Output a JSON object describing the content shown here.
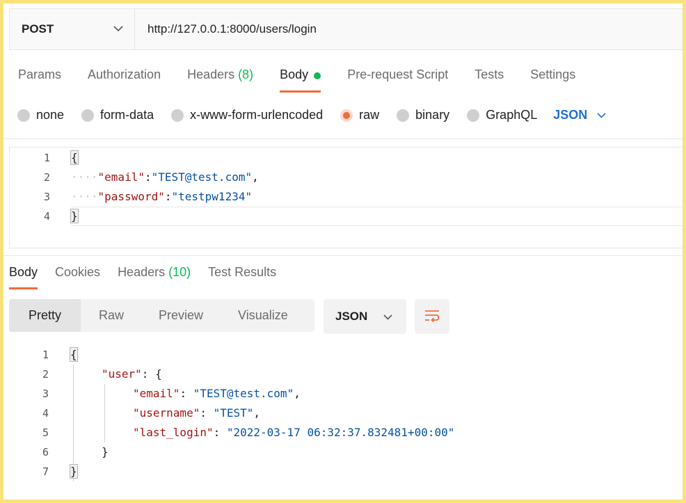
{
  "request": {
    "method": "POST",
    "url": "http://127.0.0.1:8000/users/login",
    "tabs": [
      {
        "label": "Params"
      },
      {
        "label": "Authorization"
      },
      {
        "label": "Headers",
        "count": "(8)"
      },
      {
        "label": "Body"
      },
      {
        "label": "Pre-request Script"
      },
      {
        "label": "Tests"
      },
      {
        "label": "Settings"
      }
    ],
    "body_types": [
      "none",
      "form-data",
      "x-www-form-urlencoded",
      "raw",
      "binary",
      "GraphQL"
    ],
    "selected_body_type": "raw",
    "format": "JSON",
    "code_lines": [
      {
        "n": "1",
        "open": "{"
      },
      {
        "n": "2",
        "ws": "····",
        "key": "\"email\"",
        "sep": ":",
        "val": "\"TEST@test.com\"",
        "tail": ","
      },
      {
        "n": "3",
        "ws": "····",
        "key": "\"password\"",
        "sep": ":",
        "val": "\"testpw1234\"",
        "tail": ""
      },
      {
        "n": "4",
        "close": "}"
      }
    ]
  },
  "response": {
    "tabs": [
      {
        "label": "Body"
      },
      {
        "label": "Cookies"
      },
      {
        "label": "Headers",
        "count": "(10)"
      },
      {
        "label": "Test Results"
      }
    ],
    "views": [
      "Pretty",
      "Raw",
      "Preview",
      "Visualize"
    ],
    "format": "JSON",
    "code_lines": [
      {
        "n": "1",
        "text": "{"
      },
      {
        "n": "2",
        "key": "\"user\"",
        "sep": ": ",
        "val": "{",
        "tail": ""
      },
      {
        "n": "3",
        "key": "\"email\"",
        "sep": ": ",
        "val": "\"TEST@test.com\"",
        "tail": ","
      },
      {
        "n": "4",
        "key": "\"username\"",
        "sep": ": ",
        "val": "\"TEST\"",
        "tail": ","
      },
      {
        "n": "5",
        "key": "\"last_login\"",
        "sep": ": ",
        "val": "\"2022-03-17 06:32:37.832481+00:00\"",
        "tail": ""
      },
      {
        "n": "6",
        "text": "}"
      },
      {
        "n": "7",
        "text": "}"
      }
    ]
  },
  "colors": {
    "accent": "#f26b3a",
    "green": "#0cbb52",
    "link_blue": "#1f6fd1",
    "json_key": "#a31515",
    "json_string": "#0451a5",
    "frame": "#f8e27c"
  }
}
